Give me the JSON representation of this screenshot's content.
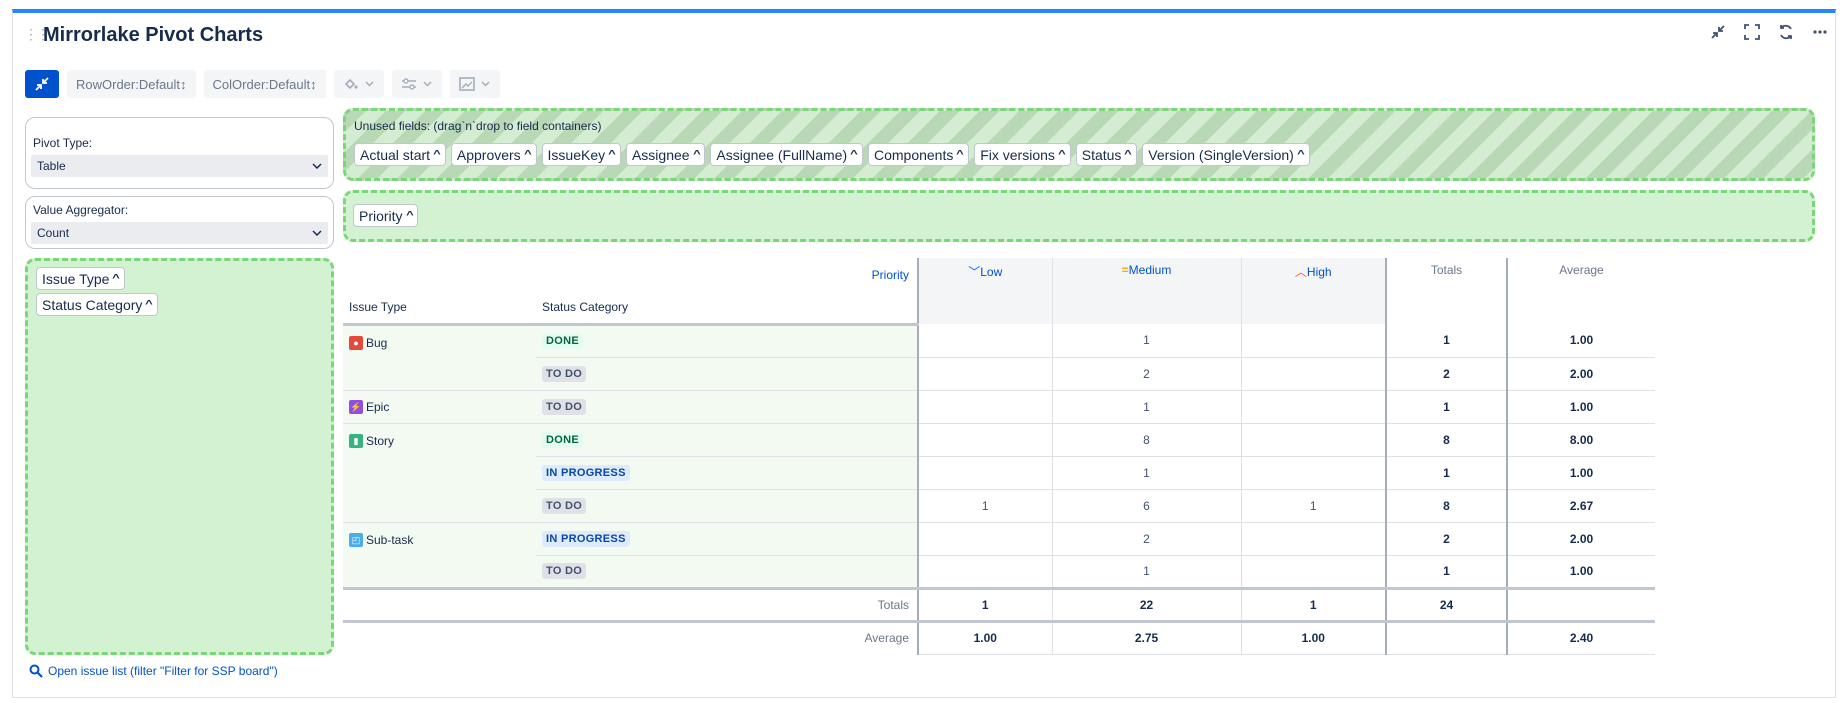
{
  "title": "Mirrorlake Pivot Charts",
  "header_icons": [
    "collapse-icon",
    "fullscreen-icon",
    "refresh-icon",
    "more-icon"
  ],
  "toolbar": {
    "row_order": "RowOrder:Default↕",
    "col_order": "ColOrder:Default↕"
  },
  "pivot_type": {
    "label": "Pivot Type:",
    "value": "Table"
  },
  "aggregator": {
    "label": "Value Aggregator:",
    "value": "Count"
  },
  "unused": {
    "label": "Unused fields: (drag`n`drop to field containers)",
    "fields": [
      "Actual start",
      "Approvers",
      "IssueKey",
      "Assignee",
      "Assignee (FullName)",
      "Components",
      "Fix versions",
      "Status",
      "Version (SingleVersion)"
    ]
  },
  "col_fields": [
    "Priority"
  ],
  "row_fields": [
    "Issue Type",
    "Status Category"
  ],
  "table": {
    "axis_label": "Priority",
    "row_headers": [
      "Issue Type",
      "Status Category"
    ],
    "columns": [
      {
        "label": "Low",
        "icon": "low-priority-icon",
        "color": "#0065ff"
      },
      {
        "label": "Medium",
        "icon": "medium-priority-icon",
        "color": "#ffab00"
      },
      {
        "label": "High",
        "icon": "high-priority-icon",
        "color": "#ff5630"
      }
    ],
    "totals_label": "Totals",
    "average_label": "Average",
    "rows": [
      {
        "type": "Bug",
        "status": "DONE",
        "values": [
          "",
          "1",
          ""
        ],
        "total": "1",
        "avg": "1.00"
      },
      {
        "type": "",
        "status": "TO DO",
        "values": [
          "",
          "2",
          ""
        ],
        "total": "2",
        "avg": "2.00"
      },
      {
        "type": "Epic",
        "status": "TO DO",
        "values": [
          "",
          "1",
          ""
        ],
        "total": "1",
        "avg": "1.00"
      },
      {
        "type": "Story",
        "status": "DONE",
        "values": [
          "",
          "8",
          ""
        ],
        "total": "8",
        "avg": "8.00"
      },
      {
        "type": "",
        "status": "IN PROGRESS",
        "values": [
          "",
          "1",
          ""
        ],
        "total": "1",
        "avg": "1.00"
      },
      {
        "type": "",
        "status": "TO DO",
        "values": [
          "1",
          "6",
          "1"
        ],
        "total": "8",
        "avg": "2.67"
      },
      {
        "type": "Sub-task",
        "status": "IN PROGRESS",
        "values": [
          "",
          "2",
          ""
        ],
        "total": "2",
        "avg": "2.00"
      },
      {
        "type": "",
        "status": "TO DO",
        "values": [
          "",
          "1",
          ""
        ],
        "total": "1",
        "avg": "1.00"
      }
    ],
    "col_totals": [
      "1",
      "22",
      "1"
    ],
    "grand_total": "24",
    "col_averages": [
      "1.00",
      "2.75",
      "1.00"
    ],
    "grand_average": "2.40"
  },
  "open_link": "Open issue list (filter \"Filter for SSP board\")"
}
